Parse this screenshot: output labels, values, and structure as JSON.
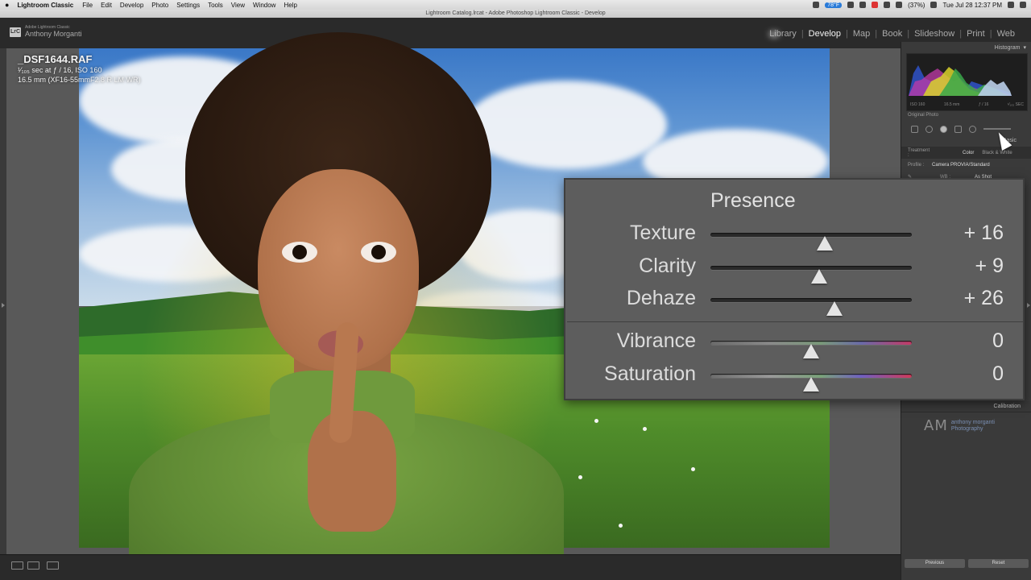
{
  "menubar": {
    "app_name": "Lightroom Classic",
    "items": [
      "File",
      "Edit",
      "Develop",
      "Photo",
      "Settings",
      "Tools",
      "View",
      "Window",
      "Help"
    ],
    "temperature": "78°F",
    "battery": "(37%)",
    "clock": "Tue Jul 28  12:37 PM"
  },
  "window_title": "Lightroom Catalog.lrcat - Adobe Photoshop Lightroom Classic - Develop",
  "identity": {
    "logo_text": "LrC",
    "brand": "Adobe Lightroom Classic",
    "owner": "Anthony Morganti"
  },
  "modules": [
    {
      "label": "Library",
      "active": false
    },
    {
      "label": "Develop",
      "active": true
    },
    {
      "label": "Map",
      "active": false
    },
    {
      "label": "Book",
      "active": false
    },
    {
      "label": "Slideshow",
      "active": false
    },
    {
      "label": "Print",
      "active": false
    },
    {
      "label": "Web",
      "active": false
    }
  ],
  "photo_info": {
    "filename": "_DSF1644.RAF",
    "exposure": "¹⁄₁₀₅ sec at ƒ / 16, ISO 160",
    "lens": "16.5 mm (XF16-55mmF2.8 R LM WR)"
  },
  "right_panel": {
    "histogram_title": "Histogram",
    "histogram_meta": [
      "ISO 160",
      "16.5 mm",
      "ƒ / 16",
      "¹⁄₁₀₅ SEC"
    ],
    "original_photo": "Original Photo",
    "basic_title": "Basic",
    "treatment_label": "Treatment :",
    "treatment_color": "Color",
    "treatment_bw": "Black & White",
    "profile_label": "Profile :",
    "profile_value": "Camera PROVIA/Standard",
    "wb_label": "WB :",
    "wb_value": "As Shot",
    "calibration_title": "Calibration",
    "signature_initials": "AM",
    "signature_name": "anthony morganti",
    "signature_sub": "Photography",
    "previous_label": "Previous",
    "reset_label": "Reset"
  },
  "presence": {
    "title": "Presence",
    "sliders": [
      {
        "label": "Texture",
        "value": "+ 16",
        "position": 0.568,
        "track": "plain"
      },
      {
        "label": "Clarity",
        "value": "+ 9",
        "position": 0.538,
        "track": "plain"
      },
      {
        "label": "Dehaze",
        "value": "+ 26",
        "position": 0.616,
        "track": "plain"
      },
      {
        "label": "Vibrance",
        "value": "0",
        "position": 0.5,
        "track": "vib"
      },
      {
        "label": "Saturation",
        "value": "0",
        "position": 0.5,
        "track": "sat"
      }
    ]
  }
}
